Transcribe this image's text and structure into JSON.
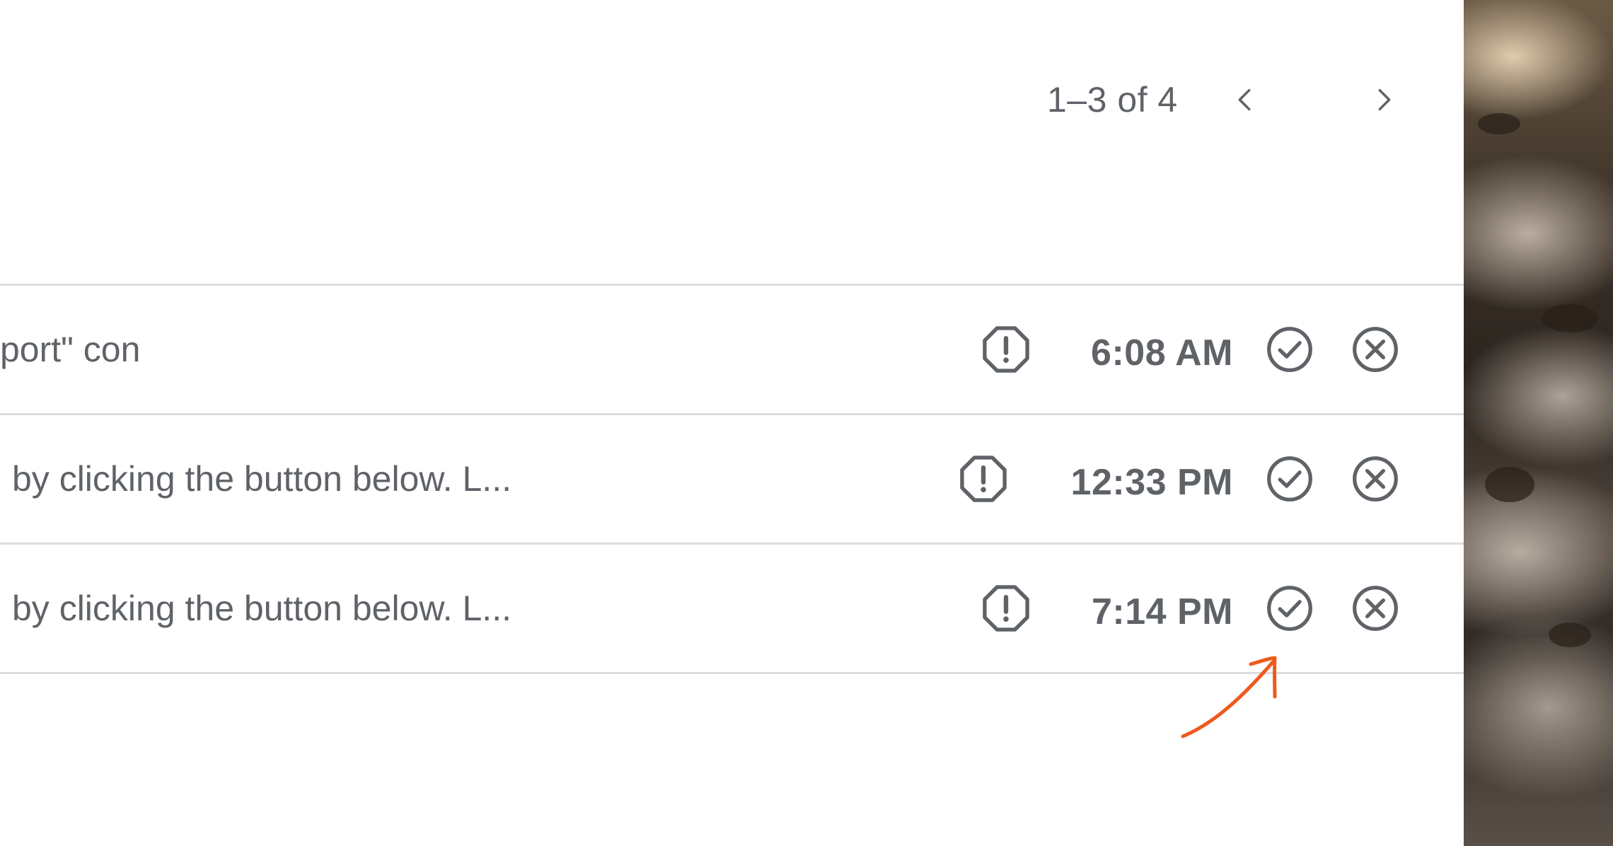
{
  "pagination": {
    "range_text": "1–3 of 4",
    "prev_icon": "chevron-left-icon",
    "next_icon": "chevron-right-icon"
  },
  "rows": [
    {
      "snippet": "port\" con",
      "time": "6:08 AM"
    },
    {
      "snippet": "by clicking the button below. L...",
      "time": "12:33 PM"
    },
    {
      "snippet": "by clicking the button below. L...",
      "time": "7:14 PM"
    }
  ],
  "icons": {
    "warning": "report-spam-icon",
    "approve": "check-circle-icon",
    "dismiss": "cancel-circle-icon"
  },
  "colors": {
    "text": "#5f6368",
    "divider": "#dcdcdc",
    "annotation": "#ee5a1c"
  }
}
